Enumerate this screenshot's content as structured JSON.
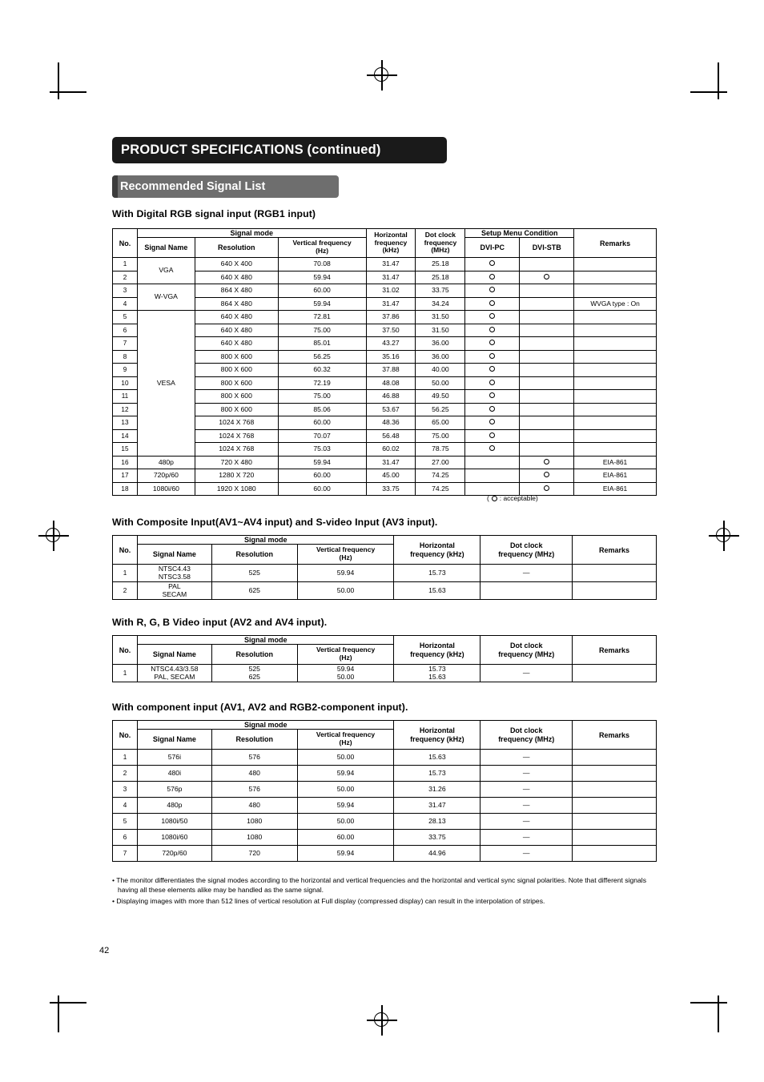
{
  "document": {
    "title": "PRODUCT SPECIFICATIONS (continued)",
    "subtitle": "Recommended Signal List",
    "page_number": "42"
  },
  "sections": {
    "digital_rgb": {
      "heading": "With Digital RGB signal input (RGB1 input)",
      "headers": {
        "no": "No.",
        "signal_mode": "Signal mode",
        "signal_name": "Signal Name",
        "resolution": "Resolution",
        "vertical_frequency": "Vertical frequency (Hz)",
        "horizontal_frequency": "Horizontal frequency (kHz)",
        "dot_clock": "Dot clock frequency (MHz)",
        "setup_menu_condition": "Setup Menu Condition",
        "dvi_pc": "DVI-PC",
        "dvi_stb": "DVI-STB",
        "remarks": "Remarks"
      },
      "rows": [
        {
          "no": "1",
          "name": "VGA",
          "resolution": "640 X 400",
          "vfreq": "70.08",
          "hfreq": "31.47",
          "dot": "25.18",
          "dvipc": true,
          "dvistb": false,
          "remarks": ""
        },
        {
          "no": "2",
          "name": "",
          "resolution": "640 X 480",
          "vfreq": "59.94",
          "hfreq": "31.47",
          "dot": "25.18",
          "dvipc": true,
          "dvistb": true,
          "remarks": ""
        },
        {
          "no": "3",
          "name": "W-VGA",
          "resolution": "864 X 480",
          "vfreq": "60.00",
          "hfreq": "31.02",
          "dot": "33.75",
          "dvipc": true,
          "dvistb": false,
          "remarks": ""
        },
        {
          "no": "4",
          "name": "",
          "resolution": "864 X 480",
          "vfreq": "59.94",
          "hfreq": "31.47",
          "dot": "34.24",
          "dvipc": true,
          "dvistb": false,
          "remarks": "WVGA type : On"
        },
        {
          "no": "5",
          "name": "",
          "resolution": "640 X 480",
          "vfreq": "72.81",
          "hfreq": "37.86",
          "dot": "31.50",
          "dvipc": true,
          "dvistb": false,
          "remarks": ""
        },
        {
          "no": "6",
          "name": "",
          "resolution": "640 X 480",
          "vfreq": "75.00",
          "hfreq": "37.50",
          "dot": "31.50",
          "dvipc": true,
          "dvistb": false,
          "remarks": ""
        },
        {
          "no": "7",
          "name": "",
          "resolution": "640 X 480",
          "vfreq": "85.01",
          "hfreq": "43.27",
          "dot": "36.00",
          "dvipc": true,
          "dvistb": false,
          "remarks": ""
        },
        {
          "no": "8",
          "name": "",
          "resolution": "800 X 600",
          "vfreq": "56.25",
          "hfreq": "35.16",
          "dot": "36.00",
          "dvipc": true,
          "dvistb": false,
          "remarks": ""
        },
        {
          "no": "9",
          "name": "",
          "resolution": "800 X 600",
          "vfreq": "60.32",
          "hfreq": "37.88",
          "dot": "40.00",
          "dvipc": true,
          "dvistb": false,
          "remarks": ""
        },
        {
          "no": "10",
          "name": "VESA",
          "resolution": "800 X 600",
          "vfreq": "72.19",
          "hfreq": "48.08",
          "dot": "50.00",
          "dvipc": true,
          "dvistb": false,
          "remarks": ""
        },
        {
          "no": "11",
          "name": "",
          "resolution": "800 X 600",
          "vfreq": "75.00",
          "hfreq": "46.88",
          "dot": "49.50",
          "dvipc": true,
          "dvistb": false,
          "remarks": ""
        },
        {
          "no": "12",
          "name": "",
          "resolution": "800 X 600",
          "vfreq": "85.06",
          "hfreq": "53.67",
          "dot": "56.25",
          "dvipc": true,
          "dvistb": false,
          "remarks": ""
        },
        {
          "no": "13",
          "name": "",
          "resolution": "1024 X 768",
          "vfreq": "60.00",
          "hfreq": "48.36",
          "dot": "65.00",
          "dvipc": true,
          "dvistb": false,
          "remarks": ""
        },
        {
          "no": "14",
          "name": "",
          "resolution": "1024 X 768",
          "vfreq": "70.07",
          "hfreq": "56.48",
          "dot": "75.00",
          "dvipc": true,
          "dvistb": false,
          "remarks": ""
        },
        {
          "no": "15",
          "name": "",
          "resolution": "1024 X 768",
          "vfreq": "75.03",
          "hfreq": "60.02",
          "dot": "78.75",
          "dvipc": true,
          "dvistb": false,
          "remarks": ""
        },
        {
          "no": "16",
          "name": "480p",
          "resolution": "720 X 480",
          "vfreq": "59.94",
          "hfreq": "31.47",
          "dot": "27.00",
          "dvipc": false,
          "dvistb": true,
          "remarks": "EIA-861"
        },
        {
          "no": "17",
          "name": "720p/60",
          "resolution": "1280 X 720",
          "vfreq": "60.00",
          "hfreq": "45.00",
          "dot": "74.25",
          "dvipc": false,
          "dvistb": true,
          "remarks": "EIA-861"
        },
        {
          "no": "18",
          "name": "1080i/60",
          "resolution": "1920 X 1080",
          "vfreq": "60.00",
          "hfreq": "33.75",
          "dot": "74.25",
          "dvipc": false,
          "dvistb": true,
          "remarks": "EIA-861"
        }
      ],
      "acceptable_note": ": acceptable)",
      "acceptable_note_open": "("
    },
    "composite": {
      "heading": "With Composite Input(AV1~AV4 input) and S-video Input (AV3 input).",
      "headers": {
        "no": "No.",
        "signal_mode": "Signal mode",
        "signal_name": "Signal Name",
        "resolution": "Resolution",
        "vertical_frequency": "Vertical frequency (Hz)",
        "horizontal_frequency": "Horizontal frequency (kHz)",
        "dot_clock": "Dot clock frequency (MHz)",
        "remarks": "Remarks"
      },
      "rows": [
        {
          "no": "1",
          "name": "NTSC4.43\nNTSC3.58",
          "resolution": "525",
          "vfreq": "59.94",
          "hfreq": "15.73",
          "dot": "—",
          "remarks": ""
        },
        {
          "no": "2",
          "name": "PAL\nSECAM",
          "resolution": "625",
          "vfreq": "50.00",
          "hfreq": "15.63",
          "dot": "",
          "remarks": ""
        }
      ]
    },
    "rgb_video": {
      "heading": "With R, G, B Video input (AV2 and AV4 input).",
      "headers": {
        "no": "No.",
        "signal_mode": "Signal mode",
        "signal_name": "Signal Name",
        "resolution": "Resolution",
        "vertical_frequency": "Vertical frequency (Hz)",
        "horizontal_frequency": "Horizontal frequency (kHz)",
        "dot_clock": "Dot clock frequency (MHz)",
        "remarks": "Remarks"
      },
      "rows": [
        {
          "no": "1",
          "name": "NTSC4.43/3.58\nPAL, SECAM",
          "resolution": "525\n625",
          "vfreq": "59.94\n50.00",
          "hfreq": "15.73\n15.63",
          "dot": "—",
          "remarks": ""
        }
      ]
    },
    "component": {
      "heading": "With component input (AV1, AV2 and RGB2-component input).",
      "headers": {
        "no": "No.",
        "signal_mode": "Signal mode",
        "signal_name": "Signal Name",
        "resolution": "Resolution",
        "vertical_frequency": "Vertical frequency (Hz)",
        "horizontal_frequency": "Horizontal frequency (kHz)",
        "dot_clock": "Dot clock frequency (MHz)",
        "remarks": "Remarks"
      },
      "rows": [
        {
          "no": "1",
          "name": "576i",
          "resolution": "576",
          "vfreq": "50.00",
          "hfreq": "15.63",
          "dot": "—",
          "remarks": ""
        },
        {
          "no": "2",
          "name": "480i",
          "resolution": "480",
          "vfreq": "59.94",
          "hfreq": "15.73",
          "dot": "—",
          "remarks": ""
        },
        {
          "no": "3",
          "name": "576p",
          "resolution": "576",
          "vfreq": "50.00",
          "hfreq": "31.26",
          "dot": "—",
          "remarks": ""
        },
        {
          "no": "4",
          "name": "480p",
          "resolution": "480",
          "vfreq": "59.94",
          "hfreq": "31.47",
          "dot": "—",
          "remarks": ""
        },
        {
          "no": "5",
          "name": "1080i/50",
          "resolution": "1080",
          "vfreq": "50.00",
          "hfreq": "28.13",
          "dot": "—",
          "remarks": ""
        },
        {
          "no": "6",
          "name": "1080i/60",
          "resolution": "1080",
          "vfreq": "60.00",
          "hfreq": "33.75",
          "dot": "—",
          "remarks": ""
        },
        {
          "no": "7",
          "name": "720p/60",
          "resolution": "720",
          "vfreq": "59.94",
          "hfreq": "44.96",
          "dot": "—",
          "remarks": ""
        }
      ]
    }
  },
  "footnotes": [
    "• The monitor differentiates the signal modes according to the horizontal and vertical frequencies and the horizontal and vertical sync signal polarities.  Note that different signals having all these elements alike may be handled as the same signal.",
    "• Displaying images with more than 512 lines of vertical resolution at Full display (compressed display) can result in the interpolation of stripes."
  ]
}
